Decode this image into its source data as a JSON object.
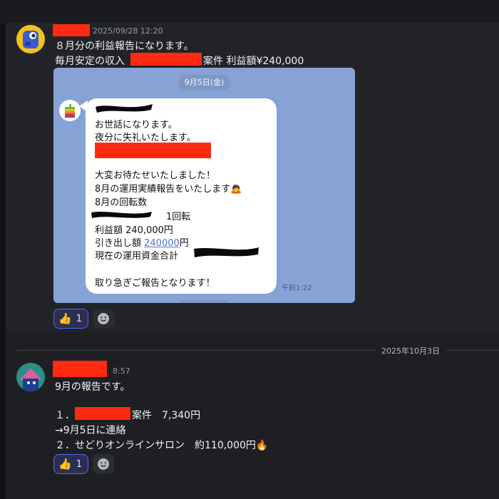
{
  "message1": {
    "timestamp": "2025/09/28 12:20",
    "lines": [
      "８月分の利益報告になります。",
      "毎月安定の収入",
      "案件 利益額¥240,000"
    ],
    "embed": {
      "date_pill": "9月5日(金)",
      "bubble_lines": [
        "お世話になります。",
        "夜分に失礼いたします。",
        "大変お待たせいたしました！",
        "8月の運用実績報告をいたします🙇",
        "8月の回転数",
        "1回転",
        "利益額 240,000円",
        "引き出し額 ",
        "240000",
        "円",
        "現在の運用資金合計",
        "取り急ぎご報告となります！"
      ],
      "time": "午前1:22"
    },
    "reaction": {
      "emoji": "👍",
      "count": "1"
    },
    "add_reaction_icon": "emoji-smile-icon"
  },
  "date_divider": "2025年10月3日",
  "message2": {
    "timestamp": "8:57",
    "lines": [
      "9月の報告です。",
      "１．",
      "案件　7,340円",
      "→9月5日に連絡",
      "２．せどりオンラインサロン　約110,000円🔥"
    ],
    "reaction": {
      "emoji": "👍",
      "count": "1"
    },
    "add_reaction_icon": "emoji-smile-icon"
  }
}
